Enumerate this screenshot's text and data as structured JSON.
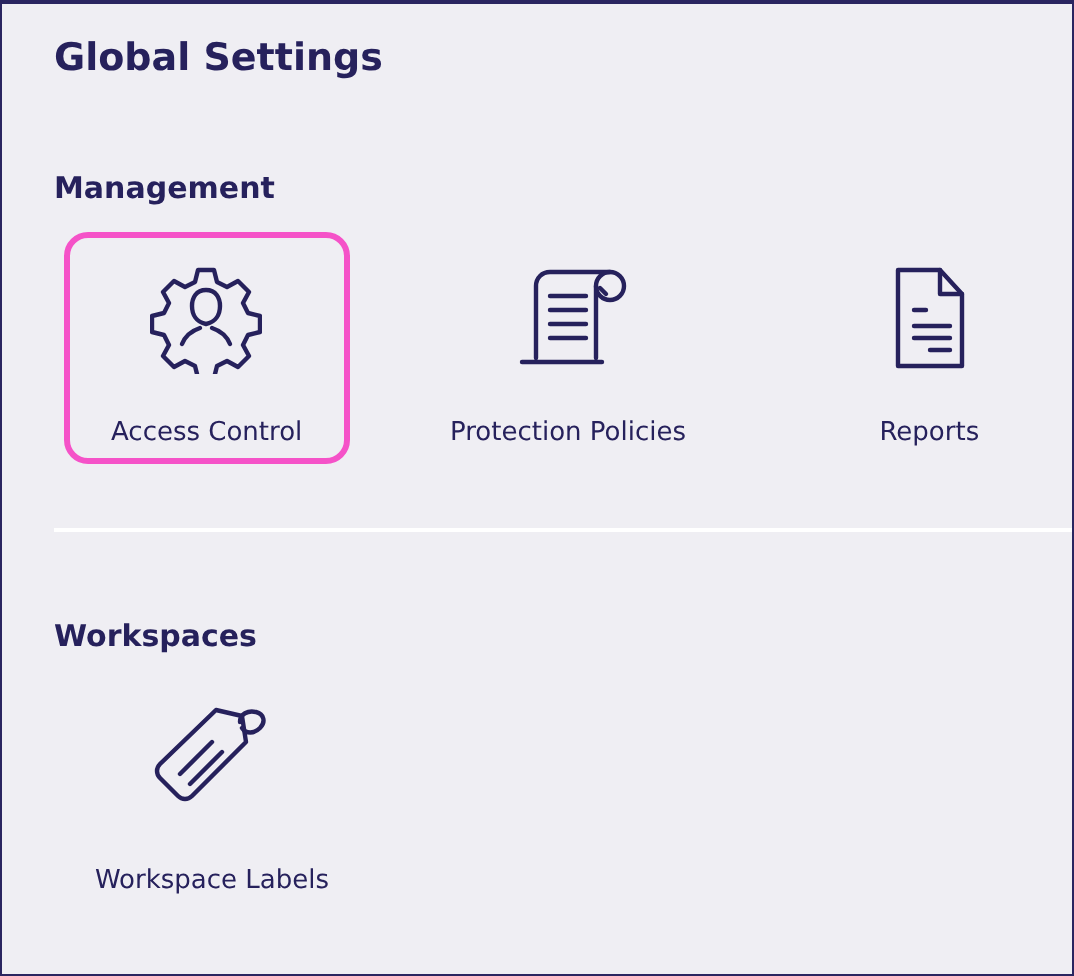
{
  "title": "Global Settings",
  "sections": [
    {
      "heading": "Management",
      "items": [
        {
          "label": "Access Control",
          "kind": "gear",
          "selected": true
        },
        {
          "label": "Protection Policies",
          "kind": "scroll",
          "selected": false
        },
        {
          "label": "Reports",
          "kind": "document",
          "selected": false
        }
      ]
    },
    {
      "heading": "Workspaces",
      "items": [
        {
          "label": "Workspace Labels",
          "kind": "tag",
          "selected": false
        }
      ]
    }
  ]
}
